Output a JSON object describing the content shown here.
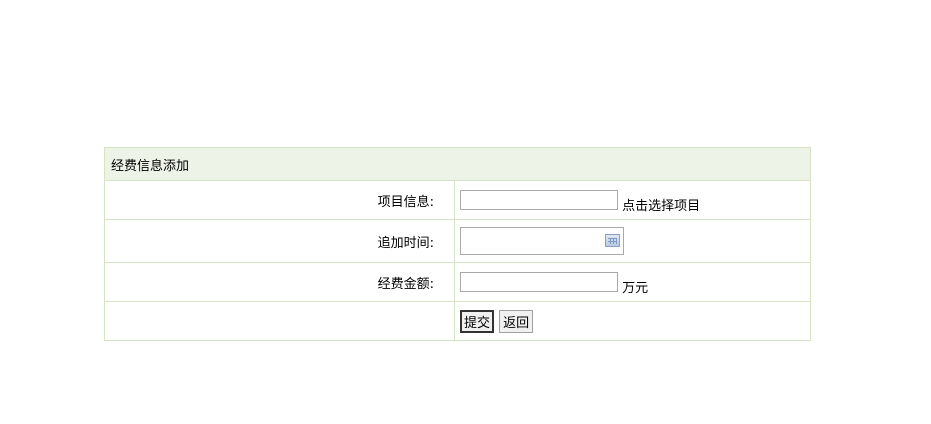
{
  "form": {
    "title": "经费信息添加",
    "rows": {
      "project": {
        "label": "项目信息:",
        "value": "",
        "link": "点击选择项目"
      },
      "date": {
        "label": "追加时间:",
        "value": ""
      },
      "amount": {
        "label": "经费金额:",
        "value": "",
        "unit": "万元"
      }
    },
    "buttons": {
      "submit": "提交",
      "back": "返回"
    }
  }
}
